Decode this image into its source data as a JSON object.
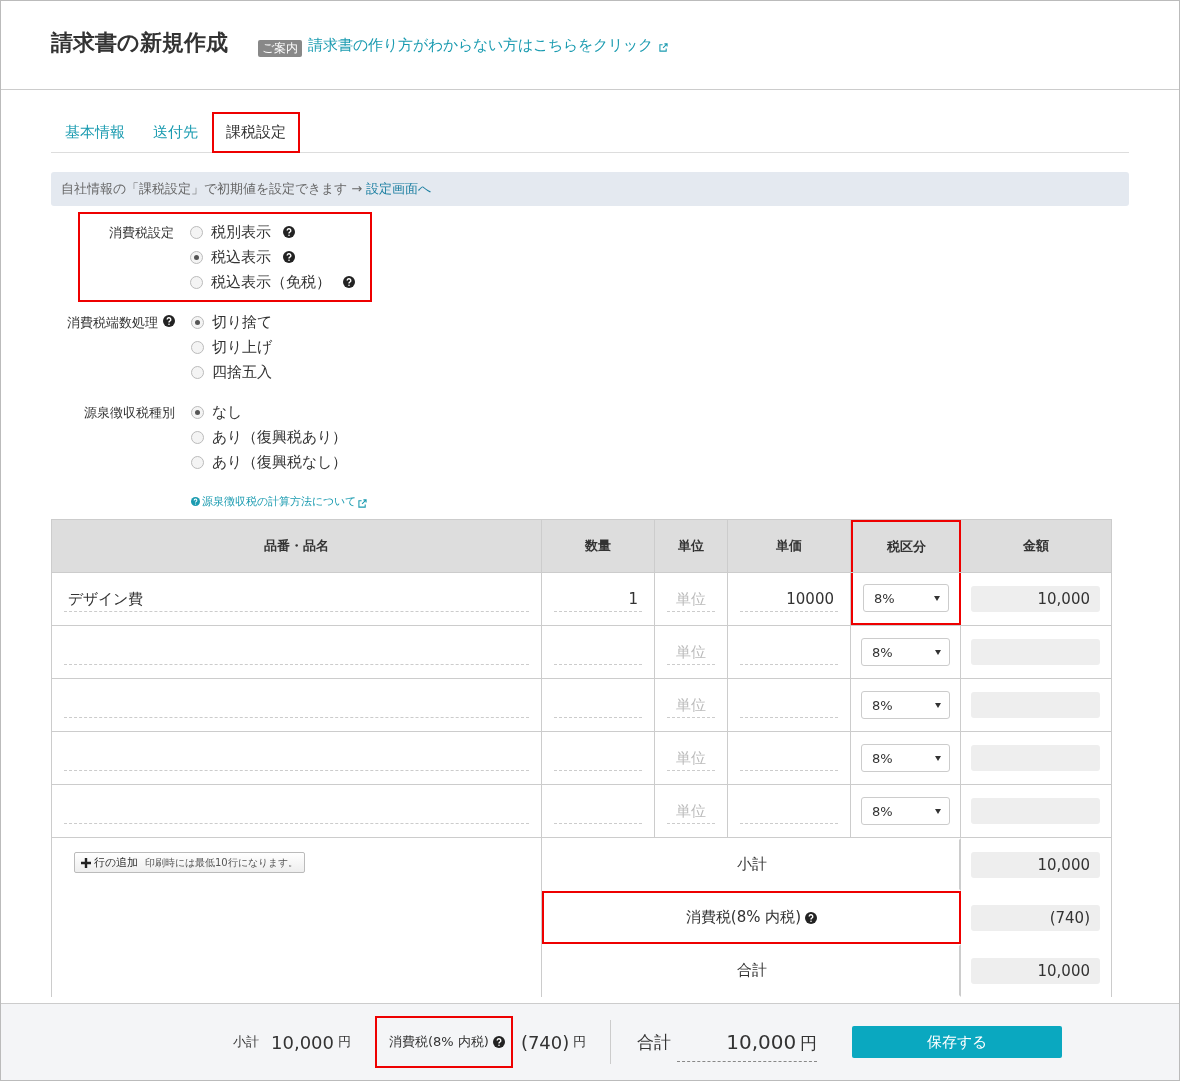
{
  "header": {
    "title": "請求書の新規作成",
    "guide_badge": "ご案内",
    "guide_link": "請求書の作り方がわからない方はこちらをクリック"
  },
  "tabs": [
    {
      "label": "基本情報",
      "selected": false,
      "highlighted": false
    },
    {
      "label": "送付先",
      "selected": false,
      "highlighted": false
    },
    {
      "label": "課税設定",
      "selected": true,
      "highlighted": true
    }
  ],
  "notice": {
    "text": "自社情報の「課税設定」で初期値を設定できます →",
    "link": "設定画面へ"
  },
  "settings": [
    {
      "label": "消費税設定",
      "label_help": false,
      "highlighted": true,
      "options": [
        {
          "label": "税別表示",
          "selected": false,
          "help": true
        },
        {
          "label": "税込表示",
          "selected": true,
          "help": true
        },
        {
          "label": "税込表示（免税）",
          "selected": false,
          "help": true
        }
      ]
    },
    {
      "label": "消費税端数処理",
      "label_help": true,
      "highlighted": false,
      "options": [
        {
          "label": "切り捨て",
          "selected": true,
          "help": false
        },
        {
          "label": "切り上げ",
          "selected": false,
          "help": false
        },
        {
          "label": "四捨五入",
          "selected": false,
          "help": false
        }
      ]
    },
    {
      "label": "源泉徴収税種別",
      "label_help": false,
      "highlighted": false,
      "options": [
        {
          "label": "なし",
          "selected": true,
          "help": false
        },
        {
          "label": "あり（復興税あり）",
          "selected": false,
          "help": false
        },
        {
          "label": "あり（復興税なし）",
          "selected": false,
          "help": false
        }
      ]
    }
  ],
  "withholding_link": "源泉徴収税の計算方法について",
  "table": {
    "columns": [
      {
        "label": "品番・品名",
        "highlighted": false
      },
      {
        "label": "数量",
        "highlighted": false
      },
      {
        "label": "単位",
        "highlighted": false
      },
      {
        "label": "単価",
        "highlighted": false
      },
      {
        "label": "税区分",
        "highlighted": true
      },
      {
        "label": "金額",
        "highlighted": false
      }
    ],
    "rows": [
      {
        "name": "デザイン費",
        "quantity": "1",
        "unit_placeholder": "単位",
        "price": "10000",
        "tax": "8%",
        "amount": "10,000"
      },
      {
        "unit_placeholder": "単位",
        "tax": "8%"
      },
      {
        "unit_placeholder": "単位",
        "tax": "8%"
      },
      {
        "unit_placeholder": "単位",
        "tax": "8%"
      },
      {
        "unit_placeholder": "単位",
        "tax": "8%"
      }
    ]
  },
  "add_row": {
    "label": "行の追加",
    "note": "印刷時には最低10行になります。"
  },
  "summary": [
    {
      "label": "小計",
      "value": "10,000",
      "help": false,
      "highlighted": false
    },
    {
      "label": "消費税(8% 内税)",
      "value": "(740)",
      "help": true,
      "highlighted": true
    },
    {
      "label": "合計",
      "value": "10,000",
      "help": false,
      "highlighted": false
    }
  ],
  "footer": {
    "subtotal_label": "小計",
    "subtotal": "10,000",
    "subtotal_unit": "円",
    "tax_label": "消費税(8% 内税)",
    "tax_highlighted": true,
    "tax": "(740)",
    "tax_unit": "円",
    "total_label": "合計",
    "total": "10,000",
    "total_unit": "円",
    "save": "保存する"
  }
}
